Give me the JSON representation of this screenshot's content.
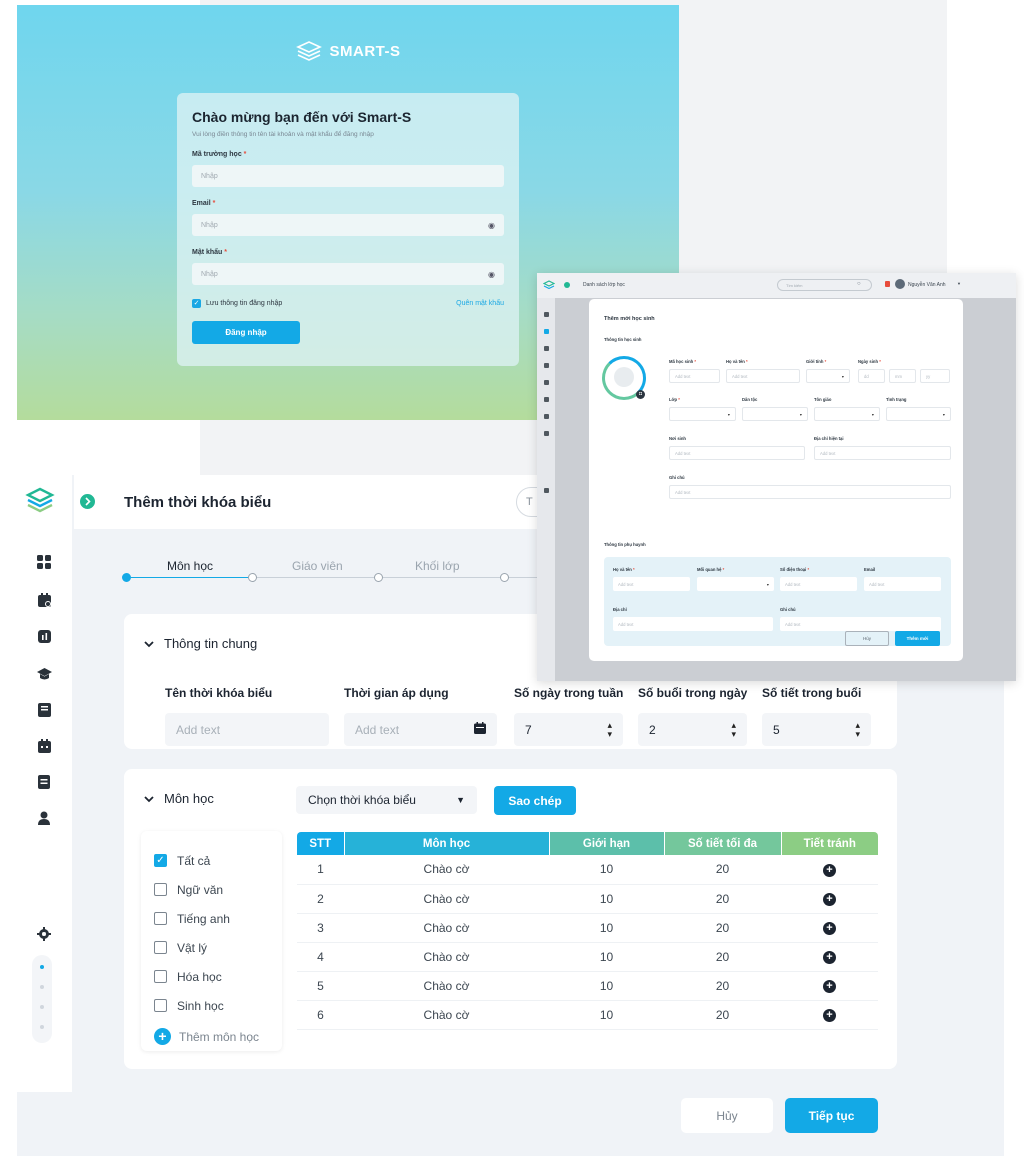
{
  "login": {
    "brand": "SMART-S",
    "title": "Chào mừng bạn đến với Smart-S",
    "subtitle": "Vui lòng điền thông tin tên tài khoản và mật khẩu để đăng nhập",
    "school_label": "Mã trường học",
    "school_placeholder": "Nhập",
    "email_label": "Email",
    "email_placeholder": "Nhập",
    "password_label": "Mật khẩu",
    "password_placeholder": "Nhập",
    "remember_label": "Lưu thông tin đăng nhập",
    "forgot_label": "Quên mật khẩu",
    "login_button": "Đăng nhập"
  },
  "schedule": {
    "page_title": "Thêm thời khóa biểu",
    "search_stub": "T",
    "steps": [
      "Môn học",
      "Giáo viên",
      "Khối lớp"
    ],
    "general": {
      "heading": "Thông tin chung",
      "name_label": "Tên thời khóa biểu",
      "name_placeholder": "Add text",
      "period_label": "Thời gian áp dụng",
      "period_placeholder": "Add text",
      "days_label": "Số ngày trong tuần",
      "days_value": "7",
      "sessions_label": "Số buổi trong ngày",
      "sessions_value": "2",
      "lessons_label": "Số tiết trong buổi",
      "lessons_value": "5"
    },
    "subjects": {
      "heading": "Môn học",
      "select_label": "Chọn thời khóa biểu",
      "copy_button": "Sao chép",
      "list": [
        "Tất cả",
        "Ngữ văn",
        "Tiếng anh",
        "Vật lý",
        "Hóa học",
        "Sinh học"
      ],
      "add_label": "Thêm môn học",
      "columns": [
        "STT",
        "Môn học",
        "Giới hạn",
        "Số tiết tối đa",
        "Tiết tránh"
      ],
      "rows": [
        [
          "1",
          "Chào cờ",
          "10",
          "20"
        ],
        [
          "2",
          "Chào cờ",
          "10",
          "20"
        ],
        [
          "3",
          "Chào cờ",
          "10",
          "20"
        ],
        [
          "4",
          "Chào cờ",
          "10",
          "20"
        ],
        [
          "5",
          "Chào cờ",
          "10",
          "20"
        ],
        [
          "6",
          "Chào cờ",
          "10",
          "20"
        ]
      ]
    },
    "cancel_button": "Hủy",
    "next_button": "Tiếp tục"
  },
  "modal_screen": {
    "app_title": "Danh sách lớp học",
    "search_placeholder": "Tìm kiếm",
    "user_name": "Nguyễn Văn Anh",
    "title": "Thêm mới học sinh",
    "student_section": "Thông tin học sinh",
    "student_id_label": "Mã học sinh",
    "full_name_label": "Họ và tên",
    "gender_label": "Giới tính",
    "dob_label": "Ngày sinh",
    "dob_dd": "dd",
    "dob_mm": "mm",
    "dob_yy": "yy",
    "class_label": "Lớp",
    "ethnic_label": "Dân tộc",
    "religion_label": "Tôn giáo",
    "status_label": "Tình trạng",
    "birthplace_label": "Nơi sinh",
    "address_label": "Địa chỉ hiện tại",
    "note_label": "Ghi chú",
    "add_text": "Add text",
    "parent_section": "Thông tin phụ huynh",
    "p_name_label": "Họ và tên",
    "p_relation_label": "Mối quan hệ",
    "p_phone_label": "Số điện thoại",
    "p_email_label": "Email",
    "p_address_label": "Địa chỉ",
    "p_note_label": "Ghi chú",
    "cancel_button": "Hủy",
    "add_button": "Thêm mới"
  }
}
